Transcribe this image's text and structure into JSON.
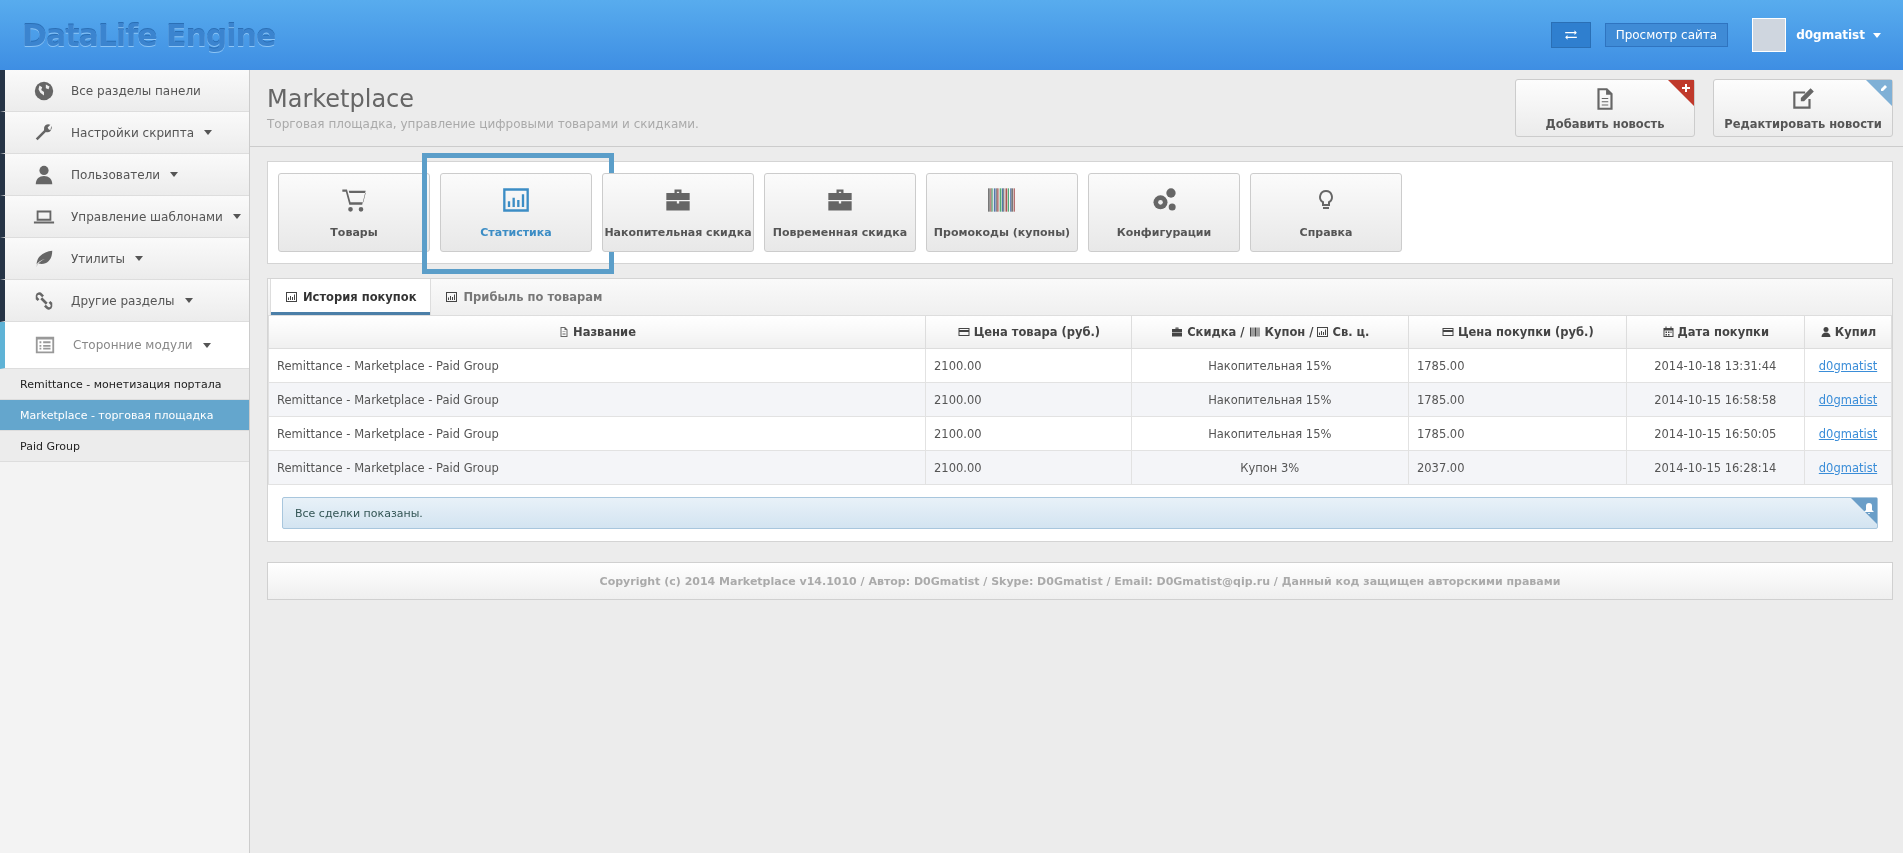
{
  "header": {
    "logo": "DataLife Engine",
    "view_site": "Просмотр сайта",
    "user": "d0gmatist"
  },
  "sidebar": {
    "items": [
      {
        "label": "Все разделы панели",
        "expandable": false,
        "selected": false
      },
      {
        "label": "Настройки скрипта",
        "expandable": true,
        "selected": false
      },
      {
        "label": "Пользователи",
        "expandable": true,
        "selected": false
      },
      {
        "label": "Управление шаблонами",
        "expandable": true,
        "selected": false
      },
      {
        "label": "Утилиты",
        "expandable": true,
        "selected": false
      },
      {
        "label": "Другие разделы",
        "expandable": true,
        "selected": false
      },
      {
        "label": "Сторонние модули",
        "expandable": true,
        "selected": true
      }
    ],
    "subitems": [
      {
        "label": "Remittance - монетизация портала",
        "selected": false
      },
      {
        "label": "Marketplace - торговая площадка",
        "selected": true
      },
      {
        "label": "Paid Group",
        "selected": false
      }
    ]
  },
  "page": {
    "title": "Marketplace",
    "subtitle": "Торговая площадка, управление цифровыми товарами и скидками.",
    "actions": [
      "Добавить новость",
      "Редактировать новости"
    ]
  },
  "modules": [
    {
      "label": "Товары",
      "selected": false
    },
    {
      "label": "Статистика",
      "selected": true
    },
    {
      "label": "Накопительная скидка",
      "selected": false
    },
    {
      "label": "Повременная скидка",
      "selected": false
    },
    {
      "label": "Промокоды (купоны)",
      "selected": false
    },
    {
      "label": "Конфигурации",
      "selected": false
    },
    {
      "label": "Справка",
      "selected": false
    }
  ],
  "tabs": [
    {
      "label": "История покупок",
      "selected": true
    },
    {
      "label": "Прибыль по товарам",
      "selected": false
    }
  ],
  "table": {
    "columns": [
      {
        "label": "Название"
      },
      {
        "label": "Цена товара (руб.)"
      },
      {
        "parts": [
          "Скидка /",
          "Купон /",
          "Св. ц."
        ]
      },
      {
        "label": "Цена покупки (руб.)"
      },
      {
        "label": "Дата покупки"
      },
      {
        "label": "Купил"
      }
    ],
    "rows": [
      [
        "Remittance - Marketplace - Paid Group",
        "2100.00",
        "Накопительная 15%",
        "1785.00",
        "2014-10-18 13:31:44",
        "d0gmatist"
      ],
      [
        "Remittance - Marketplace - Paid Group",
        "2100.00",
        "Накопительная 15%",
        "1785.00",
        "2014-10-15 16:58:58",
        "d0gmatist"
      ],
      [
        "Remittance - Marketplace - Paid Group",
        "2100.00",
        "Накопительная 15%",
        "1785.00",
        "2014-10-15 16:50:05",
        "d0gmatist"
      ],
      [
        "Remittance - Marketplace - Paid Group",
        "2100.00",
        "Купон 3%",
        "2037.00",
        "2014-10-15 16:28:14",
        "d0gmatist"
      ]
    ]
  },
  "notice": "Все сделки показаны.",
  "footer": "Copyright (c) 2014 Marketplace v14.1010 / Автор: D0Gmatist / Skype: D0Gmatist / Email: D0Gmatist@qip.ru / Данный код защищен авторскими правами"
}
